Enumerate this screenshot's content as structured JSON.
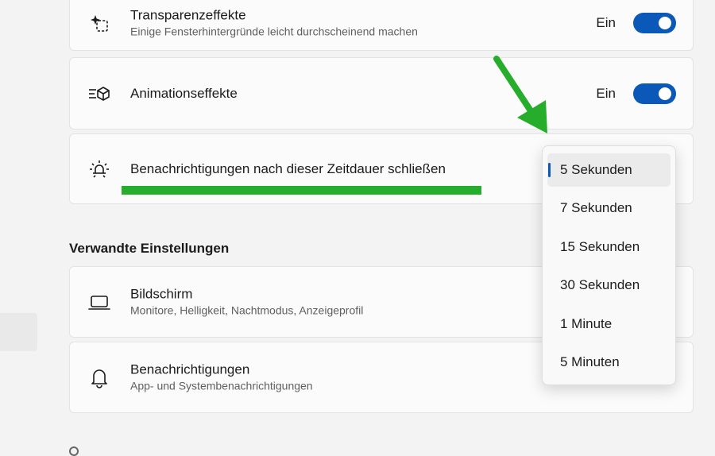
{
  "cards": {
    "transparency": {
      "title": "Transparenzeffekte",
      "subtitle": "Einige Fensterhintergründe leicht durchscheinend machen",
      "toggle_label": "Ein",
      "toggle_on": true,
      "icon": "sparkle-transparency-icon"
    },
    "animation": {
      "title": "Animationseffekte",
      "toggle_label": "Ein",
      "toggle_on": true,
      "icon": "animation-cube-icon"
    },
    "notification_timeout": {
      "title": "Benachrichtigungen nach dieser Zeitdauer schließen",
      "icon": "notification-sun-icon"
    }
  },
  "related": {
    "heading": "Verwandte Einstellungen",
    "items": [
      {
        "title": "Bildschirm",
        "subtitle": "Monitore, Helligkeit, Nachtmodus, Anzeigeprofil",
        "icon": "monitor-icon"
      },
      {
        "title": "Benachrichtigungen",
        "subtitle": "App- und Systembenachrichtigungen",
        "icon": "bell-icon"
      }
    ]
  },
  "dropdown": {
    "options": [
      "5 Sekunden",
      "7 Sekunden",
      "15 Sekunden",
      "30 Sekunden",
      "1 Minute",
      "5 Minuten"
    ],
    "selected_index": 0
  },
  "colors": {
    "accent": "#0a58b8",
    "annotation_green": "#25ad2b",
    "background": "#f3f3f3",
    "card": "#fbfbfb"
  }
}
